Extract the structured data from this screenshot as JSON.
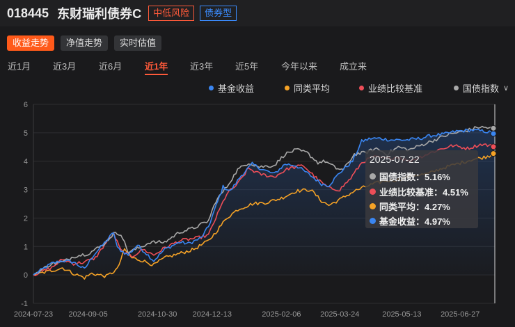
{
  "header": {
    "code": "018445",
    "name": "东财瑞利债券C",
    "risk_tag": "中低风险",
    "type_tag": "债券型"
  },
  "mode_tabs": [
    "收益走势",
    "净值走势",
    "实时估值"
  ],
  "range_tabs": [
    "近1月",
    "近3月",
    "近6月",
    "近1年",
    "近3年",
    "近5年",
    "今年以来",
    "成立来"
  ],
  "active_range": "近1年",
  "legend_chevron": "chevron-down-icon",
  "tooltip": {
    "date": "2025-07-22",
    "rows": [
      {
        "label": "国债指数：5.16%",
        "series": "国债指数"
      },
      {
        "label": "业绩比较基准：4.51%",
        "series": "业绩比较基准"
      },
      {
        "label": "同类平均：4.27%",
        "series": "同类平均"
      },
      {
        "label": "基金收益：4.97%",
        "series": "基金收益"
      }
    ]
  },
  "chart_data": {
    "type": "line",
    "title": "",
    "xlabel": "",
    "ylabel": "",
    "ylim": [
      -1,
      6
    ],
    "yticks": [
      -1,
      0,
      1,
      2,
      3,
      4,
      5,
      6
    ],
    "xtick_labels": [
      "2024-07-23",
      "2024-09-05",
      "2024-10-30",
      "2024-12-13",
      "2025-02-06",
      "2025-03-24",
      "2025-05-13",
      "2025-06-27"
    ],
    "xtick_indices": [
      0,
      30,
      68,
      98,
      136,
      168,
      202,
      234
    ],
    "n_points": 254,
    "grid": "horizontal",
    "legend_position": "top-right",
    "series": [
      {
        "name": "基金收益",
        "color": "#3a86f2",
        "area": true,
        "keypoints": [
          [
            0,
            0
          ],
          [
            10,
            0.4
          ],
          [
            16,
            0.5
          ],
          [
            22,
            0.45
          ],
          [
            28,
            0.2
          ],
          [
            33,
            0.7
          ],
          [
            38,
            1.05
          ],
          [
            44,
            1.5
          ],
          [
            46,
            0.95
          ],
          [
            52,
            0.7
          ],
          [
            57,
            1.05
          ],
          [
            62,
            0.75
          ],
          [
            66,
            0.5
          ],
          [
            72,
            0.9
          ],
          [
            80,
            1.15
          ],
          [
            85,
            1.1
          ],
          [
            92,
            1.3
          ],
          [
            96,
            1.7
          ],
          [
            100,
            2.4
          ],
          [
            104,
            3.1
          ],
          [
            108,
            2.95
          ],
          [
            114,
            3.5
          ],
          [
            120,
            3.9
          ],
          [
            126,
            3.7
          ],
          [
            132,
            3.55
          ],
          [
            138,
            3.9
          ],
          [
            144,
            3.85
          ],
          [
            152,
            3.5
          ],
          [
            158,
            3.2
          ],
          [
            162,
            3.15
          ],
          [
            168,
            3.6
          ],
          [
            175,
            4.0
          ],
          [
            180,
            4.7
          ],
          [
            185,
            4.8
          ],
          [
            190,
            4.8
          ],
          [
            196,
            4.75
          ],
          [
            205,
            4.75
          ],
          [
            212,
            4.8
          ],
          [
            218,
            4.9
          ],
          [
            225,
            4.95
          ],
          [
            232,
            5.05
          ],
          [
            240,
            5.1
          ],
          [
            248,
            5.05
          ],
          [
            253,
            4.97
          ]
        ]
      },
      {
        "name": "同类平均",
        "color": "#f5a226",
        "area": false,
        "keypoints": [
          [
            0,
            0
          ],
          [
            10,
            0.15
          ],
          [
            16,
            0.25
          ],
          [
            22,
            0.05
          ],
          [
            28,
            -0.1
          ],
          [
            32,
            0.05
          ],
          [
            40,
            -0.05
          ],
          [
            46,
            0.2
          ],
          [
            50,
            0.9
          ],
          [
            54,
            0.6
          ],
          [
            60,
            0.5
          ],
          [
            66,
            0.35
          ],
          [
            72,
            0.6
          ],
          [
            80,
            0.75
          ],
          [
            88,
            0.9
          ],
          [
            96,
            1.2
          ],
          [
            100,
            1.5
          ],
          [
            106,
            2.0
          ],
          [
            112,
            2.3
          ],
          [
            120,
            2.5
          ],
          [
            128,
            2.55
          ],
          [
            136,
            2.7
          ],
          [
            144,
            2.95
          ],
          [
            152,
            3.0
          ],
          [
            158,
            2.6
          ],
          [
            162,
            2.45
          ],
          [
            168,
            2.65
          ],
          [
            176,
            2.95
          ],
          [
            184,
            3.15
          ],
          [
            192,
            3.3
          ],
          [
            200,
            3.35
          ],
          [
            208,
            3.5
          ],
          [
            216,
            3.55
          ],
          [
            224,
            3.75
          ],
          [
            232,
            3.9
          ],
          [
            240,
            4.05
          ],
          [
            248,
            4.15
          ],
          [
            253,
            4.27
          ]
        ]
      },
      {
        "name": "业绩比较基准",
        "color": "#ee4e58",
        "area": false,
        "keypoints": [
          [
            0,
            0
          ],
          [
            10,
            0.25
          ],
          [
            16,
            0.55
          ],
          [
            22,
            0.4
          ],
          [
            28,
            0.45
          ],
          [
            34,
            0.6
          ],
          [
            40,
            1.15
          ],
          [
            44,
            1.45
          ],
          [
            48,
            0.85
          ],
          [
            54,
            0.65
          ],
          [
            60,
            0.9
          ],
          [
            66,
            0.7
          ],
          [
            72,
            0.95
          ],
          [
            80,
            1.2
          ],
          [
            90,
            1.3
          ],
          [
            96,
            1.4
          ],
          [
            100,
            2.0
          ],
          [
            106,
            2.85
          ],
          [
            112,
            3.2
          ],
          [
            118,
            3.75
          ],
          [
            124,
            3.55
          ],
          [
            132,
            3.45
          ],
          [
            140,
            3.75
          ],
          [
            148,
            3.85
          ],
          [
            156,
            3.35
          ],
          [
            162,
            3.05
          ],
          [
            168,
            3.0
          ],
          [
            174,
            3.4
          ],
          [
            180,
            3.95
          ],
          [
            186,
            4.15
          ],
          [
            194,
            4.1
          ],
          [
            200,
            4.15
          ],
          [
            206,
            4.0
          ],
          [
            214,
            4.2
          ],
          [
            222,
            4.4
          ],
          [
            230,
            4.55
          ],
          [
            238,
            4.45
          ],
          [
            246,
            4.6
          ],
          [
            253,
            4.51
          ]
        ]
      },
      {
        "name": "国债指数",
        "color": "#a9a9a9",
        "area": false,
        "keypoints": [
          [
            0,
            0
          ],
          [
            10,
            0.4
          ],
          [
            16,
            0.45
          ],
          [
            22,
            0.65
          ],
          [
            30,
            0.75
          ],
          [
            38,
            1.05
          ],
          [
            44,
            1.45
          ],
          [
            48,
            1.45
          ],
          [
            52,
            0.8
          ],
          [
            58,
            0.95
          ],
          [
            64,
            1.15
          ],
          [
            72,
            1.15
          ],
          [
            80,
            1.5
          ],
          [
            88,
            1.65
          ],
          [
            96,
            1.9
          ],
          [
            100,
            2.6
          ],
          [
            106,
            3.1
          ],
          [
            112,
            3.7
          ],
          [
            118,
            3.95
          ],
          [
            124,
            3.8
          ],
          [
            132,
            3.85
          ],
          [
            138,
            4.25
          ],
          [
            144,
            4.4
          ],
          [
            150,
            4.3
          ],
          [
            156,
            3.95
          ],
          [
            160,
            4.0
          ],
          [
            166,
            3.75
          ],
          [
            170,
            3.7
          ],
          [
            176,
            4.25
          ],
          [
            182,
            4.3
          ],
          [
            188,
            4.45
          ],
          [
            194,
            4.25
          ],
          [
            200,
            4.5
          ],
          [
            206,
            4.4
          ],
          [
            214,
            4.6
          ],
          [
            220,
            4.75
          ],
          [
            228,
            4.95
          ],
          [
            236,
            5.05
          ],
          [
            244,
            5.2
          ],
          [
            253,
            5.16
          ]
        ]
      }
    ]
  }
}
